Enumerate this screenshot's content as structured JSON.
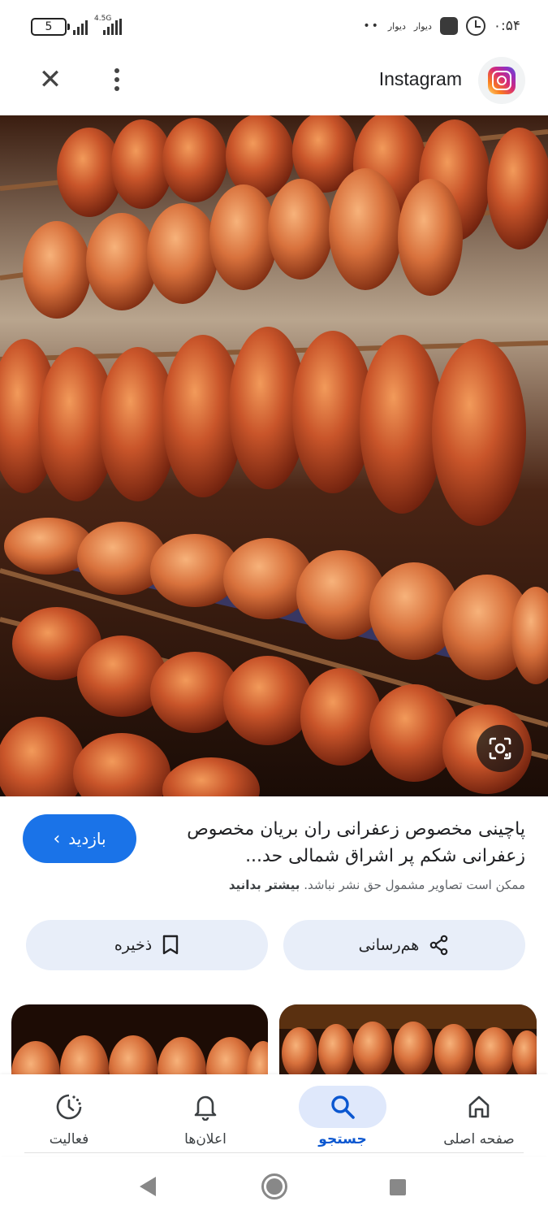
{
  "status_bar": {
    "battery": "5",
    "network": "4.5G",
    "app_labels": [
      "دیوار",
      "دیوار"
    ],
    "dots": "••",
    "time": "۰:۵۴"
  },
  "header": {
    "site_name": "Instagram",
    "site_icon": "instagram-logo",
    "close_icon": "close-icon",
    "more_icon": "more-vert-icon"
  },
  "result": {
    "visit_label": "بازدید",
    "title": "پاچینی مخصوص زعفرانی ران بریان مخصوص زعفرانی شکم پر اشراق شمالی حد...",
    "copyright_text": "ممکن است تصاویر مشمول حق نشر نباشد.",
    "learn_more": "بیشتر بدانید"
  },
  "actions": {
    "share_label": "هم‌رسانی",
    "save_label": "ذخیره"
  },
  "bottom_nav": {
    "items": [
      {
        "label": "صفحه اصلی",
        "icon": "home-icon"
      },
      {
        "label": "جستجو",
        "icon": "search-icon"
      },
      {
        "label": "اعلان‌ها",
        "icon": "bell-icon"
      },
      {
        "label": "فعالیت",
        "icon": "activity-icon"
      }
    ],
    "active": "جستجو"
  },
  "colors": {
    "accent": "#1a73e8",
    "chip_bg": "#e8eef9",
    "active_nav_bg": "#dfe8fb"
  }
}
